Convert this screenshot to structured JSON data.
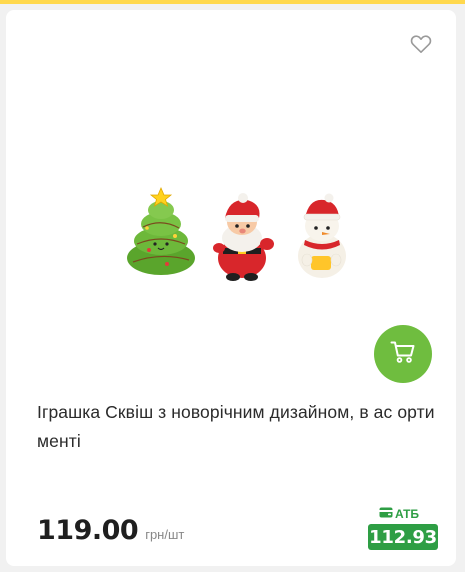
{
  "product": {
    "title": "Іграшка Сквіш з новорічним дизайном, в ас ортименті",
    "price": "119.00",
    "unit": "грн/шт",
    "promo_label": "АТБ",
    "promo_price": "112.93"
  },
  "icons": {
    "favorite": "heart-outline-icon",
    "cart": "shopping-cart-icon",
    "promo": "wallet-card-icon"
  },
  "colors": {
    "accent_yellow": "#ffd84d",
    "cart_green": "#6fbd3f",
    "promo_green": "#2e9e44"
  }
}
